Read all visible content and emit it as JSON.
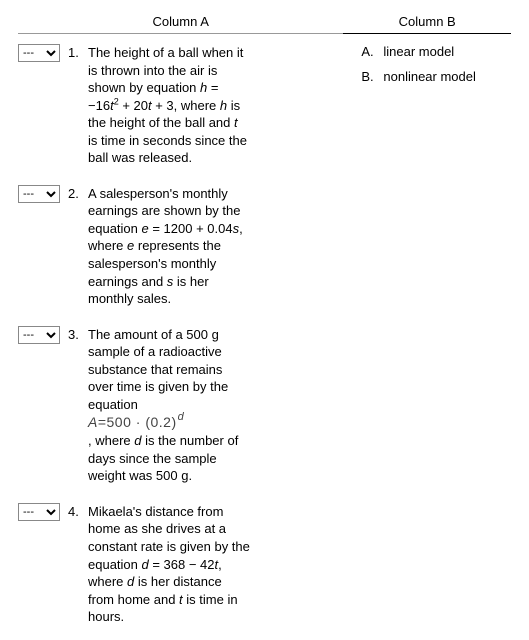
{
  "headers": {
    "a": "Column A",
    "b": "Column B"
  },
  "select_placeholder": "---",
  "questions": {
    "q1": {
      "num": "1.",
      "l1": "The height of a ball when it",
      "l2": "is thrown into the air is",
      "l3a": "shown by equation ",
      "l3var": "h",
      "l3b": " =",
      "l4a": "−16",
      "l4var1": "t",
      "l4sup": "2",
      "l4b": " + 20",
      "l4var2": "t",
      "l4c": " + 3, where ",
      "l4var3": "h",
      "l4d": " is",
      "l5a": "the height of the ball and ",
      "l5var": "t",
      "l6": "is time in seconds since the",
      "l7": "ball was released."
    },
    "q2": {
      "num": "2.",
      "l1": "A salesperson's monthly",
      "l2": "earnings are shown by the",
      "l3a": "equation ",
      "l3var1": "e",
      "l3b": " = 1200 + 0.04",
      "l3var2": "s",
      "l3c": ",",
      "l4a": "where ",
      "l4var": "e",
      "l4b": " represents the",
      "l5": "salesperson's monthly",
      "l6a": "earnings and ",
      "l6var": "s",
      "l6b": " is her",
      "l7": "monthly sales."
    },
    "q3": {
      "num": "3.",
      "l1": "The amount of a 500 g",
      "l2": "sample of a radioactive",
      "l3": "substance that remains",
      "l4": "over time is given by the",
      "l5": "equation",
      "eqA": "A",
      "eqB": "=500 · (0.2)",
      "eqSup": "d",
      "l6a": ", where ",
      "l6var": "d",
      "l6b": " is the number of",
      "l7": "days since the sample",
      "l8": "weight was 500 g."
    },
    "q4": {
      "num": "4.",
      "l1": "Mikaela's distance from",
      "l2": "home as she drives at a",
      "l3": "constant rate is given by the",
      "l4a": "equation ",
      "l4var1": "d",
      "l4b": " = 368 − 42",
      "l4var2": "t",
      "l4c": ",",
      "l5a": "where ",
      "l5var": "d",
      "l5b": " is her distance",
      "l6a": "from home and ",
      "l6var": "t",
      "l6b": " is time in",
      "l7": "hours."
    }
  },
  "answers": {
    "a": {
      "letter": "A.",
      "text": "linear model"
    },
    "b": {
      "letter": "B.",
      "text": "nonlinear model"
    }
  }
}
